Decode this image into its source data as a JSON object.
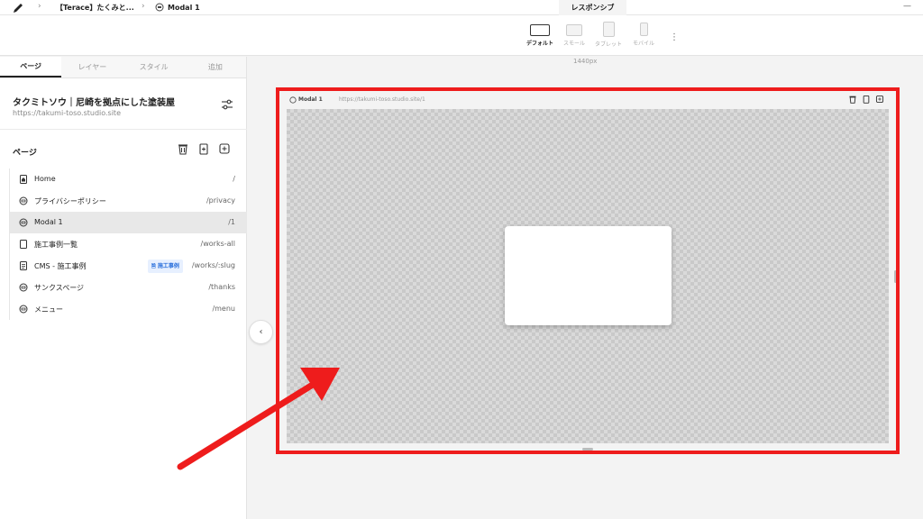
{
  "topbar": {
    "breadcrumb_project": "【Terace】たくみと...",
    "breadcrumb_page": "Modal 1",
    "responsive_tab": "レスポンシブ"
  },
  "toolbar": {
    "devices": [
      {
        "label": "デフォルト",
        "active": true
      },
      {
        "label": "スモール",
        "active": false
      },
      {
        "label": "タブレット",
        "active": false
      },
      {
        "label": "モバイル",
        "active": false
      }
    ]
  },
  "panel": {
    "tabs": [
      "ページ",
      "レイヤー",
      "スタイル",
      "追加"
    ],
    "active_tab": "ページ",
    "site_title": "タクミトソウ｜尼崎を拠点にした塗装屋",
    "site_url": "https://takumi-toso.studio.site",
    "pages_heading": "ページ",
    "pages": [
      {
        "name": "Home",
        "path": "/",
        "icon": "home-icon",
        "selected": false
      },
      {
        "name": "プライバシーポリシー",
        "path": "/privacy",
        "icon": "link-page-icon",
        "selected": false
      },
      {
        "name": "Modal 1",
        "path": "/1",
        "icon": "modal-icon",
        "selected": true
      },
      {
        "name": "施工事例一覧",
        "path": "/works-all",
        "icon": "page-icon",
        "selected": false
      },
      {
        "name": "CMS - 施工事例",
        "path": "/works/:slug",
        "icon": "cms-icon",
        "badge": "施工事例",
        "selected": false
      },
      {
        "name": "サンクスページ",
        "path": "/thanks",
        "icon": "link-page-icon",
        "selected": false
      },
      {
        "name": "メニュー",
        "path": "/menu",
        "icon": "link-page-icon",
        "selected": false
      }
    ]
  },
  "canvas": {
    "width_label": "1440px",
    "frame_name": "Modal 1",
    "frame_url": "https://takumi-toso.studio.site/1"
  },
  "colors": {
    "highlight": "#ee1c1c",
    "badge_bg": "#e7f0ff",
    "badge_text": "#2a6fdb"
  }
}
